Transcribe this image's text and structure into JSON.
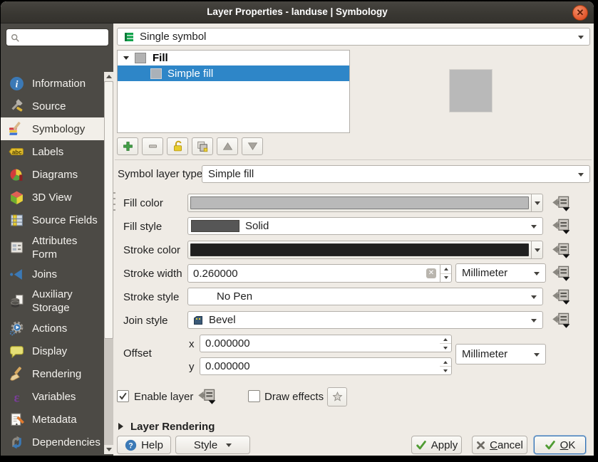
{
  "window": {
    "title": "Layer Properties - landuse | Symbology"
  },
  "sidebar": {
    "search": {
      "placeholder": ""
    },
    "items": [
      {
        "label": "Information",
        "icon": "information-icon"
      },
      {
        "label": "Source",
        "icon": "source-icon"
      },
      {
        "label": "Symbology",
        "icon": "symbology-icon",
        "selected": true
      },
      {
        "label": "Labels",
        "icon": "labels-icon"
      },
      {
        "label": "Diagrams",
        "icon": "diagrams-icon"
      },
      {
        "label": "3D View",
        "icon": "3d-view-icon"
      },
      {
        "label": "Source Fields",
        "icon": "source-fields-icon"
      },
      {
        "label": "Attributes Form",
        "icon": "attributes-form-icon"
      },
      {
        "label": "Joins",
        "icon": "joins-icon"
      },
      {
        "label": "Auxiliary Storage",
        "icon": "auxiliary-storage-icon"
      },
      {
        "label": "Actions",
        "icon": "actions-icon"
      },
      {
        "label": "Display",
        "icon": "display-icon"
      },
      {
        "label": "Rendering",
        "icon": "rendering-icon"
      },
      {
        "label": "Variables",
        "icon": "variables-icon"
      },
      {
        "label": "Metadata",
        "icon": "metadata-icon"
      },
      {
        "label": "Dependencies",
        "icon": "dependencies-icon"
      }
    ]
  },
  "main": {
    "symbol_type_value": "Single symbol",
    "symbol_tree": {
      "root_label": "Fill",
      "child_label": "Simple fill"
    },
    "layer_type": {
      "label": "Symbol layer type",
      "value": "Simple fill"
    },
    "rows": {
      "fill_color": {
        "label": "Fill color"
      },
      "fill_style": {
        "label": "Fill style",
        "value": "Solid"
      },
      "stroke_color": {
        "label": "Stroke color"
      },
      "stroke_width": {
        "label": "Stroke width",
        "value": "0.260000",
        "unit": "Millimeter"
      },
      "stroke_style": {
        "label": "Stroke style",
        "value": "No Pen"
      },
      "join_style": {
        "label": "Join style",
        "value": "Bevel"
      },
      "offset": {
        "label": "Offset",
        "x_label": "x",
        "x_value": "0.000000",
        "y_label": "y",
        "y_value": "0.000000",
        "unit": "Millimeter"
      }
    },
    "enable_layer_label": "Enable layer",
    "draw_effects_label": "Draw effects",
    "layer_rendering_label": "Layer Rendering"
  },
  "footer": {
    "help_label": "Help",
    "style_label": "Style",
    "apply_label": "Apply",
    "cancel_label": "Cancel",
    "ok_label": "OK"
  },
  "colors": {
    "fill_preview": "#b9b9b9",
    "tree_swatch": "#b2b2b2",
    "tree_swatch_selected": "#aab1b8",
    "fill_style_swatch": "#565656",
    "stroke_color": "#1f1f1f",
    "selection_blue": "#2e86c8",
    "symbol_green": "#12a34c",
    "close_button": "#e2562c"
  }
}
